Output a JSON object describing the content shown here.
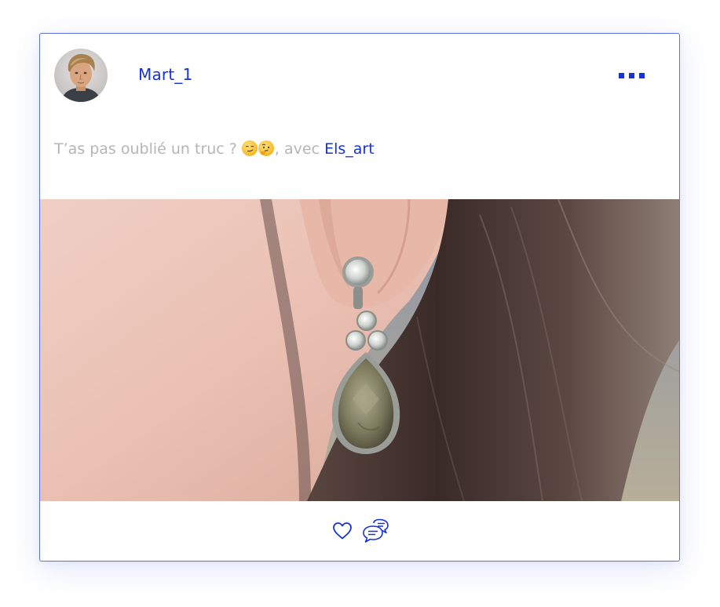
{
  "post": {
    "username": "Mart_1",
    "caption": {
      "text": "T’as pas oublié un truc ? ",
      "emojis": [
        "smirking-face-emoji",
        "thinking-face-emoji"
      ],
      "with_text": ", avec ",
      "mention": "Els_art"
    }
  },
  "icons": {
    "more": "more-options-icon",
    "like": "heart-icon",
    "comment": "comments-icon"
  },
  "colors": {
    "accent": "#1333d9",
    "caption_text": "#b5b5b8",
    "border": "#5b72d8"
  }
}
